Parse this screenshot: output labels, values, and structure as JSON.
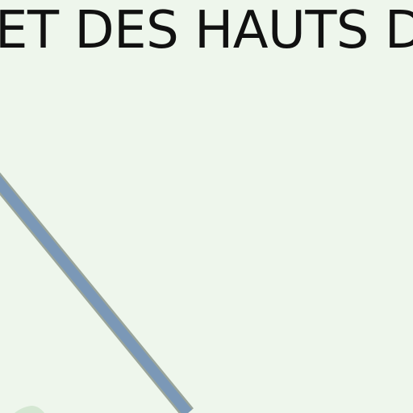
{
  "map": {
    "region_label": "ET DES HAUTS DE",
    "colors": {
      "background": "#eef6ec",
      "road_casing": "#9aa59b",
      "road_fill": "#7b98b7",
      "green_patch": "#d4e7d2",
      "label_text": "#111111"
    }
  }
}
